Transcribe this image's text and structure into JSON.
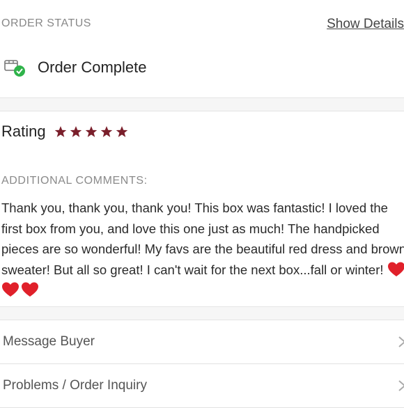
{
  "order": {
    "section_label": "ORDER STATUS",
    "show_details_label": "Show Details",
    "status_text": "Order Complete"
  },
  "rating": {
    "label": "Rating",
    "stars": 5,
    "star_color": "#7a1f2b"
  },
  "comments": {
    "label": "ADDITIONAL COMMENTS:",
    "text": "Thank you, thank you, thank you! This box was fantastic! I loved the first box from you, and love this one just as much! The handpicked pieces are so wonderful! My favs are the beautiful red dress and brown sweater! But all so great! I can't wait for the next box...fall or winter!",
    "emoji": "heart-icon",
    "emoji_count": 3
  },
  "actions": [
    {
      "label": "Message Buyer",
      "icon": "chevron-right-icon"
    },
    {
      "label": "Problems / Order Inquiry",
      "icon": "chevron-right-icon"
    }
  ],
  "colors": {
    "accent_green": "#2fb34a",
    "star": "#7a1f2b",
    "heart": "#e0202a"
  }
}
